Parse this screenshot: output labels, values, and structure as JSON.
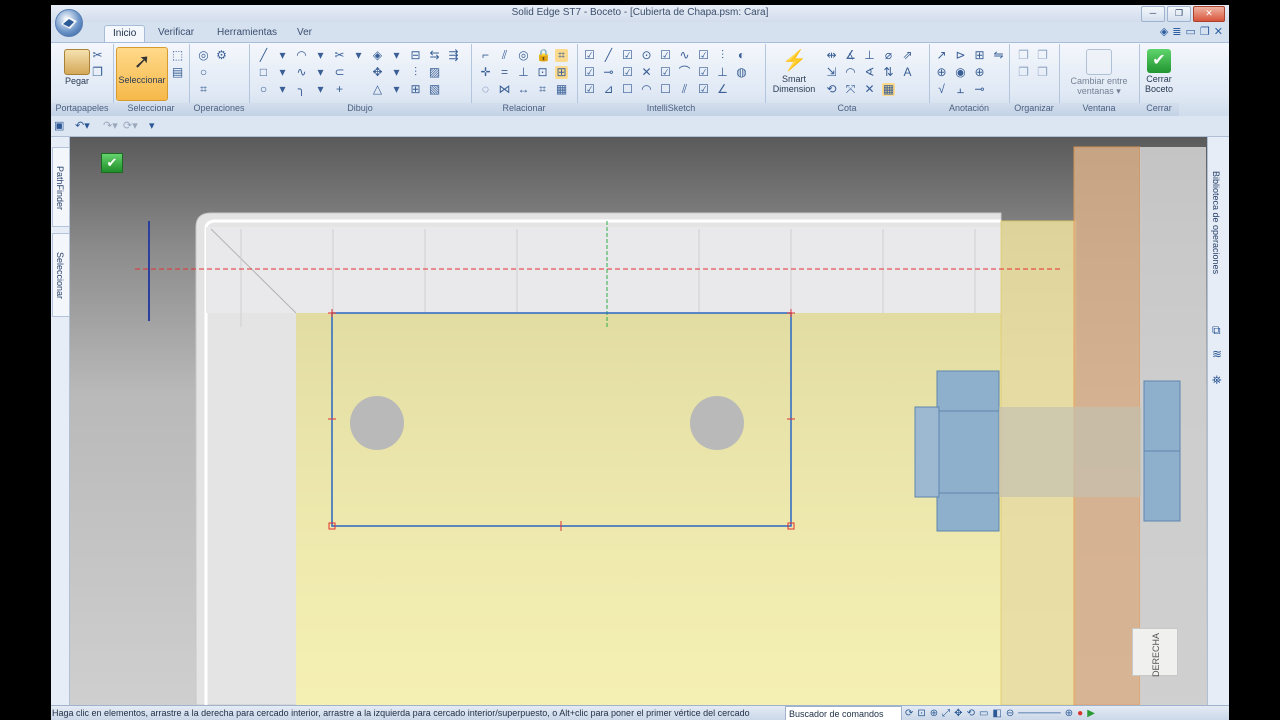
{
  "window": {
    "title": "Solid Edge ST7 - Boceto - [Cubierta de Chapa.psm: Cara]",
    "buttons": [
      "─",
      "❐",
      "✕"
    ]
  },
  "ribbon_tabs": [
    "Inicio",
    "Verificar",
    "Herramientas",
    "Ver"
  ],
  "groups": {
    "portapapeles": {
      "label": "Portapapeles",
      "paste": "Pegar"
    },
    "seleccionar": {
      "label": "Seleccionar",
      "select": "Seleccionar"
    },
    "operaciones": {
      "label": "Operaciones"
    },
    "dibujo": {
      "label": "Dibujo"
    },
    "relacionar": {
      "label": "Relacionar"
    },
    "intellisketch": {
      "label": "IntelliSketch"
    },
    "cota": {
      "label": "Cota",
      "smart_dimension": "Smart Dimension"
    },
    "anotacion": {
      "label": "Anotación"
    },
    "organizar": {
      "label": "Organizar"
    },
    "ventana": {
      "label": "Ventana",
      "switch": "Cambiar entre ventanas ▾"
    },
    "cerrar": {
      "label": "Cerrar",
      "close_sketch": "Cerrar Boceto"
    }
  },
  "left_tabs": [
    "PathFinder",
    "Seleccionar"
  ],
  "right_tab": "Biblioteca de operaciones",
  "view_label": "DERECHA",
  "status": {
    "prompt": "Haga clic en elementos, arrastre a la derecha para cercado interior, arrastre a la izquierda para cercado interior/superpuesto, o Alt+clic para poner el primer vértice del cercado",
    "command_finder": "Buscador de comandos"
  },
  "colors": {
    "sketch_line": "#2a66c4",
    "part_yellow": "#f0eaa6",
    "selection_red": "#e23030",
    "accent_orange": "#f6b94a"
  }
}
